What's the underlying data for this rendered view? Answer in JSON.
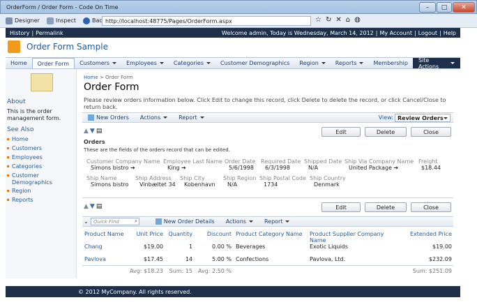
{
  "window": {
    "title": "OrderForm / Order Form - Code On Time"
  },
  "browser": {
    "designer_label": "Designer",
    "inspect_label": "Inspect",
    "back_label": "Back",
    "url": "http://localhost:48775/Pages/OrderForm.aspx"
  },
  "topnav": {
    "history": "History",
    "permalink": "Permalink",
    "welcome": "Welcome admin, Today is Wednesday, March 14, 2012",
    "my_account": "My Account",
    "logout": "Logout",
    "help": "Help"
  },
  "app": {
    "title": "Order Form Sample"
  },
  "menu": {
    "items": [
      "Home",
      "Order Form",
      "Customers",
      "Employees",
      "Categories",
      "Customer Demographics",
      "Region",
      "Reports",
      "Membership"
    ],
    "site_actions": "Site Actions"
  },
  "sidebar": {
    "about_title": "About",
    "about_text": "This is the order management form.",
    "see_also_title": "See Also",
    "links": [
      "Home",
      "Customers",
      "Employees",
      "Categories",
      "Customer Demographics",
      "Region",
      "Reports"
    ]
  },
  "page": {
    "breadcrumb_home": "Home",
    "breadcrumb_sep": ">",
    "breadcrumb_current": "Order Form",
    "title": "Order Form",
    "intro": "Please review orders information below. Click Edit to change this record, click Delete to delete the record, or click Cancel/Close to return back."
  },
  "orders_bar": {
    "new": "New Orders",
    "actions": "Actions",
    "report": "Report",
    "view_label": "View:",
    "view_value": "Review Orders"
  },
  "buttons": {
    "edit": "Edit",
    "delete": "Delete",
    "close": "Close"
  },
  "orders": {
    "section_title": "Orders",
    "section_desc": "These are the fields of the orders record that can be edited.",
    "fields": {
      "customer_company_name": {
        "label": "Customer Company Name",
        "value": "Simons bistro"
      },
      "employee_last_name": {
        "label": "Employee Last Name",
        "value": "King"
      },
      "order_date": {
        "label": "Order Date",
        "value": "5/6/1998"
      },
      "required_date": {
        "label": "Required Date",
        "value": "6/3/1998"
      },
      "shipped_date": {
        "label": "Shipped Date",
        "value": "N/A"
      },
      "ship_via": {
        "label": "Ship Via Company Name",
        "value": "United Package"
      },
      "freight": {
        "label": "Freight",
        "value": "$18.44"
      },
      "ship_name": {
        "label": "Ship Name",
        "value": "Simons bistro"
      },
      "ship_address": {
        "label": "Ship Address",
        "value": "Vinbæltet 34"
      },
      "ship_city": {
        "label": "Ship City",
        "value": "Kobenhavn"
      },
      "ship_region": {
        "label": "Ship Region",
        "value": "N/A"
      },
      "ship_postal_code": {
        "label": "Ship Postal Code",
        "value": "1734"
      },
      "ship_country": {
        "label": "Ship Country",
        "value": "Denmark"
      }
    }
  },
  "details_bar": {
    "quick_find": "Quick Find",
    "new": "New Order Details",
    "actions": "Actions",
    "report": "Report"
  },
  "details": {
    "columns": [
      "Product Name",
      "Unit Price",
      "Quantity",
      "Discount",
      "Product Category Name",
      "Product Supplier Company Name",
      "Extended Price"
    ],
    "rows": [
      [
        "Chang",
        "$19.00",
        "1",
        "0.00 %",
        "Beverages",
        "Exotic Liquids",
        "$19.00"
      ],
      [
        "Pavlova",
        "$17.45",
        "14",
        "5.00 %",
        "Confections",
        "Pavlova, Ltd.",
        "$232.09"
      ]
    ],
    "totals": {
      "avg_price": "Avg: $18.23",
      "sum_qty": "Sum: 15",
      "avg_discount": "Avg: 2.50 %",
      "sum_extended": "Sum: $251.09"
    }
  },
  "footer": {
    "copyright": "© 2012 MyCompany. All rights reserved."
  }
}
